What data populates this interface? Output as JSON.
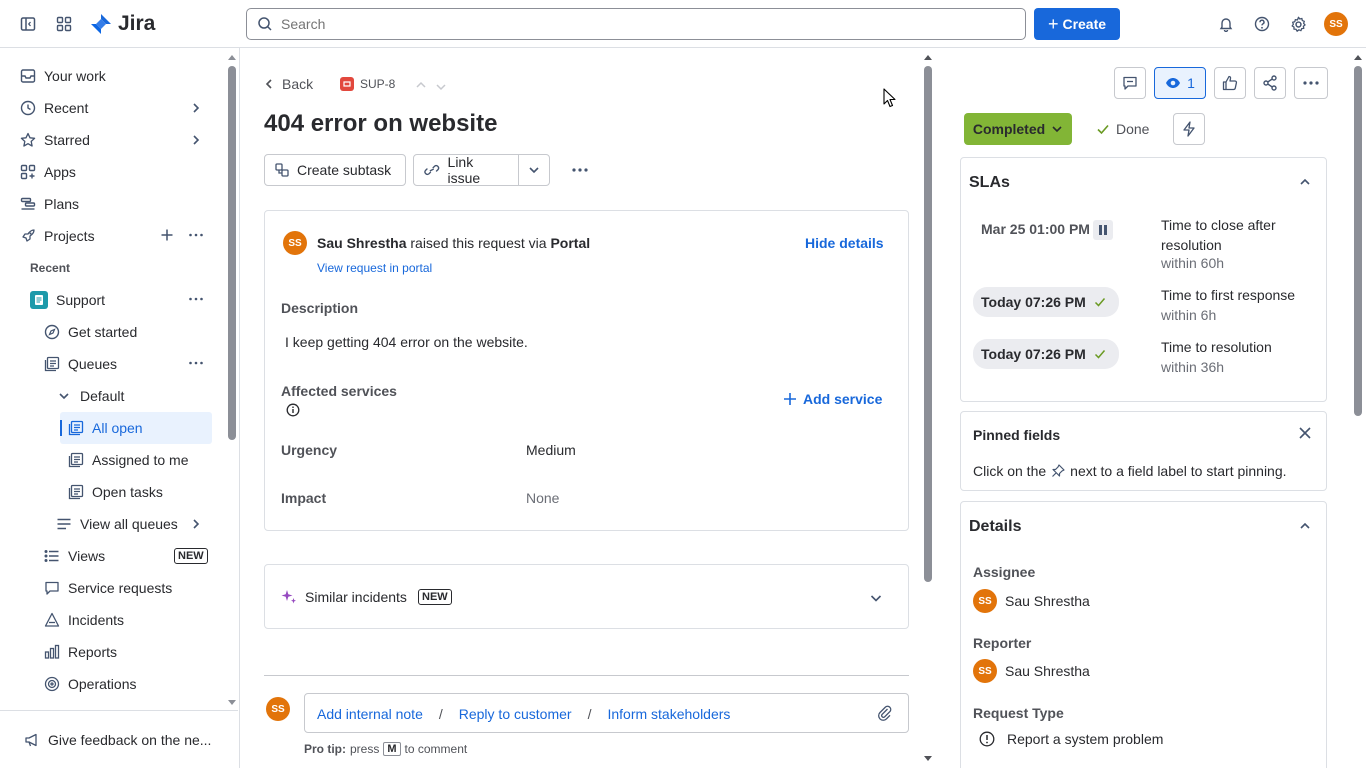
{
  "topbar": {
    "app_name": "Jira",
    "search_placeholder": "Search",
    "create_label": "Create",
    "user_initials": "SS"
  },
  "sidebar": {
    "your_work": "Your work",
    "recent": "Recent",
    "starred": "Starred",
    "apps": "Apps",
    "plans": "Plans",
    "projects": "Projects",
    "recent_header": "Recent",
    "project_name": "Support",
    "get_started": "Get started",
    "queues": "Queues",
    "default": "Default",
    "all_open": "All open",
    "assigned_to_me": "Assigned to me",
    "open_tasks": "Open tasks",
    "view_all_queues": "View all queues",
    "views": "Views",
    "views_badge": "NEW",
    "service_requests": "Service requests",
    "incidents": "Incidents",
    "reports": "Reports",
    "operations": "Operations",
    "feedback": "Give feedback on the ne..."
  },
  "issue": {
    "back_label": "Back",
    "key": "SUP-8",
    "title": "404 error on website",
    "create_subtask": "Create subtask",
    "link_issue": "Link issue",
    "requester_name": "Sau Shrestha",
    "requester_initials": "SS",
    "raised_text": "raised this request via",
    "channel": "Portal",
    "view_in_portal": "View request in portal",
    "hide_details": "Hide details",
    "description_label": "Description",
    "description_text": "I keep getting 404 error on the website.",
    "affected_services_label": "Affected services",
    "add_service": "Add service",
    "urgency_label": "Urgency",
    "urgency_value": "Medium",
    "impact_label": "Impact",
    "impact_value": "None",
    "similar_incidents": "Similar incidents",
    "similar_badge": "NEW",
    "commenter_initials": "SS",
    "add_internal_note": "Add internal note",
    "reply_to_customer": "Reply to customer",
    "inform_stakeholders": "Inform stakeholders",
    "sep1": "/",
    "sep2": "/",
    "pro_tip_prefix": "Pro tip:",
    "pro_tip_press": "press",
    "pro_tip_key": "M",
    "pro_tip_suffix": "to comment"
  },
  "right_panel": {
    "watchers_count": "1",
    "status": "Completed",
    "resolution": "Done",
    "slas": {
      "title": "SLAs",
      "items": [
        {
          "time": "Mar 25 01:00 PM",
          "name": "Time to close after resolution",
          "target": "within 60h"
        },
        {
          "time": "Today 07:26 PM",
          "name": "Time to first response",
          "target": "within 6h"
        },
        {
          "time": "Today 07:26 PM",
          "name": "Time to resolution",
          "target": "within 36h"
        }
      ]
    },
    "pinned": {
      "title": "Pinned fields",
      "text_before": "Click on the",
      "text_after": "next to a field label to start pinning."
    },
    "details": {
      "title": "Details",
      "assignee_label": "Assignee",
      "assignee_name": "Sau Shrestha",
      "assignee_initials": "SS",
      "reporter_label": "Reporter",
      "reporter_name": "Sau Shrestha",
      "reporter_initials": "SS",
      "request_type_label": "Request Type",
      "request_type_value": "Report a system problem"
    }
  },
  "colors": {
    "brand": "#1868db",
    "status_green": "#82b536",
    "avatar_orange": "#e2740a"
  }
}
